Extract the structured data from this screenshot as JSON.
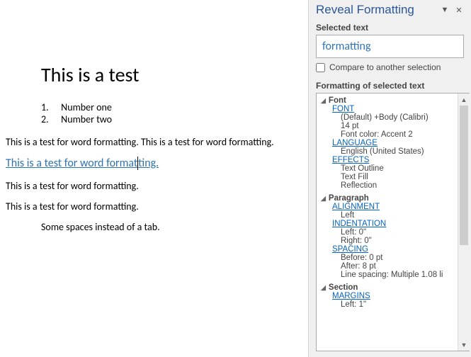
{
  "doc": {
    "title": "This is a test",
    "list": [
      {
        "num": "1.",
        "text": "Number one"
      },
      {
        "num": "2.",
        "text": "Number two"
      }
    ],
    "para1": "This is a test for word formatting. This is a test for word formatting.",
    "para2a": "This is a test for word format",
    "para2b": "ting.",
    "para3": "This is a test for word formatting.",
    "para4": "This is a test for word formatting.",
    "para5": "Some spaces instead of a tab."
  },
  "panel": {
    "title": "Reveal Formatting",
    "selected_label": "Selected text",
    "selected_value": "formatting",
    "compare_label": "Compare to another selection",
    "formatting_label": "Formatting of selected text"
  },
  "tree": {
    "font": {
      "head": "Font",
      "font_link": "FONT",
      "font_val1": "(Default) +Body (Calibri)",
      "font_val2": "14 pt",
      "font_val3": "Font color: Accent 2",
      "lang_link": "LANGUAGE",
      "lang_val": "English (United States)",
      "eff_link": "EFFECTS",
      "eff_val1": "Text Outline",
      "eff_val2": "Text Fill",
      "eff_val3": "Reflection"
    },
    "para": {
      "head": "Paragraph",
      "align_link": "ALIGNMENT",
      "align_val": "Left",
      "indent_link": "INDENTATION",
      "indent_val1": "Left:  0\"",
      "indent_val2": "Right:  0\"",
      "spacing_link": "SPACING",
      "spacing_val1": "Before:  0 pt",
      "spacing_val2": "After:  8 pt",
      "spacing_val3": "Line spacing:  Multiple 1.08 li"
    },
    "section": {
      "head": "Section",
      "margins_link": "MARGINS",
      "margins_val1": "Left:  1\""
    }
  }
}
